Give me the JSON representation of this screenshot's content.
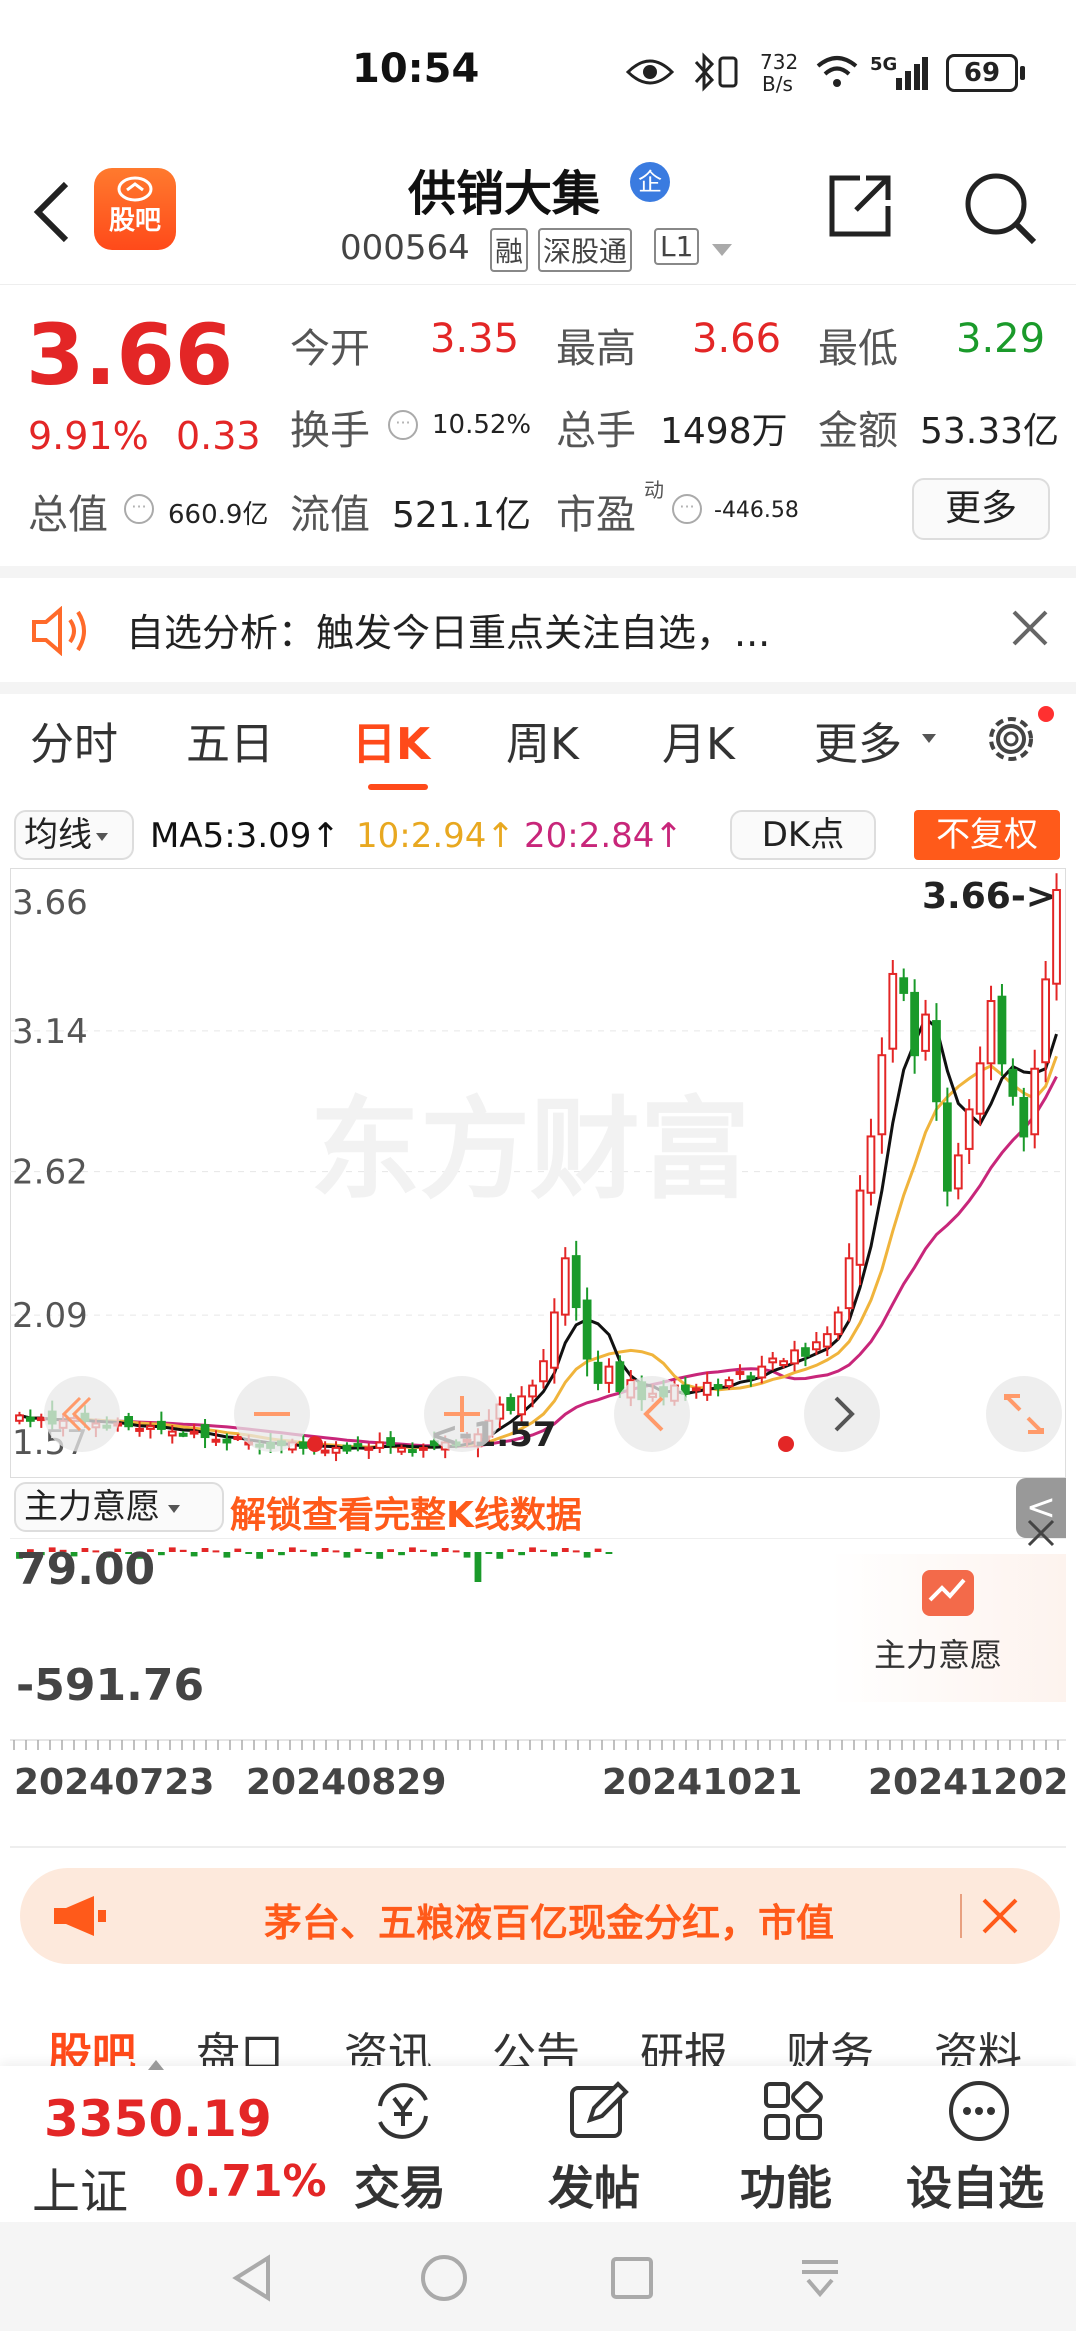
{
  "status": {
    "time": "10:54",
    "net_speed_top": "732",
    "net_speed_bottom": "B/s",
    "signal": "5G",
    "battery": "69"
  },
  "header": {
    "title": "供销大集",
    "badge": "企",
    "code": "000564",
    "tags": [
      "融",
      "深股通",
      "L1"
    ],
    "logo_text": "股吧"
  },
  "quote": {
    "price": "3.66",
    "change_pct": "9.91%",
    "change_amt": "0.33",
    "open_label": "今开",
    "open": "3.35",
    "high_label": "最高",
    "high": "3.66",
    "low_label": "最低",
    "low": "3.29",
    "turnover_label": "换手",
    "turnover": "10.52%",
    "volume_label": "总手",
    "volume": "1498万",
    "amount_label": "金额",
    "amount": "53.33亿",
    "mktcap_label": "总值",
    "mktcap": "660.9亿",
    "float_label": "流值",
    "float_cap": "521.1亿",
    "pe_label": "市盈",
    "pe_sup": "动",
    "pe": "-446.58",
    "more_label": "更多"
  },
  "notice": {
    "text": "自选分析：触发今日重点关注自选，..."
  },
  "tabs": [
    "分时",
    "五日",
    "日K",
    "周K",
    "月K",
    "更多"
  ],
  "active_tab": "日K",
  "ma_bar": {
    "selector": "均线",
    "ma5": "MA5:3.09↑",
    "ma10": "10:2.94↑",
    "ma20": "20:2.84↑",
    "dk": "DK点",
    "fq": "不复权"
  },
  "chart_data": {
    "type": "candlestick",
    "y_ticks": [
      "3.66",
      "3.14",
      "2.62",
      "2.09",
      "1.57"
    ],
    "ylim": [
      1.57,
      3.66
    ],
    "max_label": "3.66->",
    "min_label": "<-1.57",
    "watermark": "东方财富",
    "x_ticks": [
      "20240723",
      "20240829",
      "20241021",
      "20241202"
    ],
    "colors": {
      "up": "#e32626",
      "down": "#1a9a2a",
      "ma5": "#111111",
      "ma10": "#f0b43c",
      "ma20": "#c8267a"
    },
    "closes": [
      1.72,
      1.7,
      1.71,
      1.69,
      1.7,
      1.71,
      1.7,
      1.69,
      1.68,
      1.69,
      1.68,
      1.67,
      1.68,
      1.67,
      1.66,
      1.65,
      1.66,
      1.64,
      1.63,
      1.62,
      1.64,
      1.62,
      1.61,
      1.6,
      1.61,
      1.62,
      1.6,
      1.61,
      1.59,
      1.6,
      1.59,
      1.61,
      1.6,
      1.62,
      1.61,
      1.6,
      1.59,
      1.6,
      1.61,
      1.62,
      1.61,
      1.63,
      1.65,
      1.7,
      1.76,
      1.74,
      1.79,
      1.83,
      1.92,
      2.1,
      2.3,
      2.12,
      1.93,
      1.84,
      1.9,
      1.81,
      1.85,
      1.78,
      1.8,
      1.79,
      1.83,
      1.8,
      1.82,
      1.84,
      1.82,
      1.85,
      1.88,
      1.86,
      1.9,
      1.93,
      1.92,
      1.96,
      1.94,
      1.99,
      2.02,
      2.1,
      2.3,
      2.55,
      2.75,
      3.05,
      3.35,
      3.28,
      3.05,
      3.2,
      2.88,
      2.55,
      2.68,
      2.85,
      3.02,
      3.25,
      3.02,
      2.9,
      2.75,
      3.0,
      3.33,
      3.66
    ]
  },
  "indicator": {
    "selector": "主力意愿",
    "unlock": "解锁查看完整K线数据",
    "top": "79.00",
    "bottom": "-591.76",
    "badge_label": "主力意愿"
  },
  "promo": {
    "text": "茅台、五粮液百亿现金分红，市值"
  },
  "bottom_tabs": [
    "股吧",
    "盘口",
    "资讯",
    "公告",
    "研报",
    "财务",
    "资料"
  ],
  "bottom_bar": {
    "index_value": "3350.19",
    "index_name": "上证",
    "index_pct": "0.71%",
    "actions": [
      "交易",
      "发帖",
      "功能",
      "设自选"
    ]
  }
}
